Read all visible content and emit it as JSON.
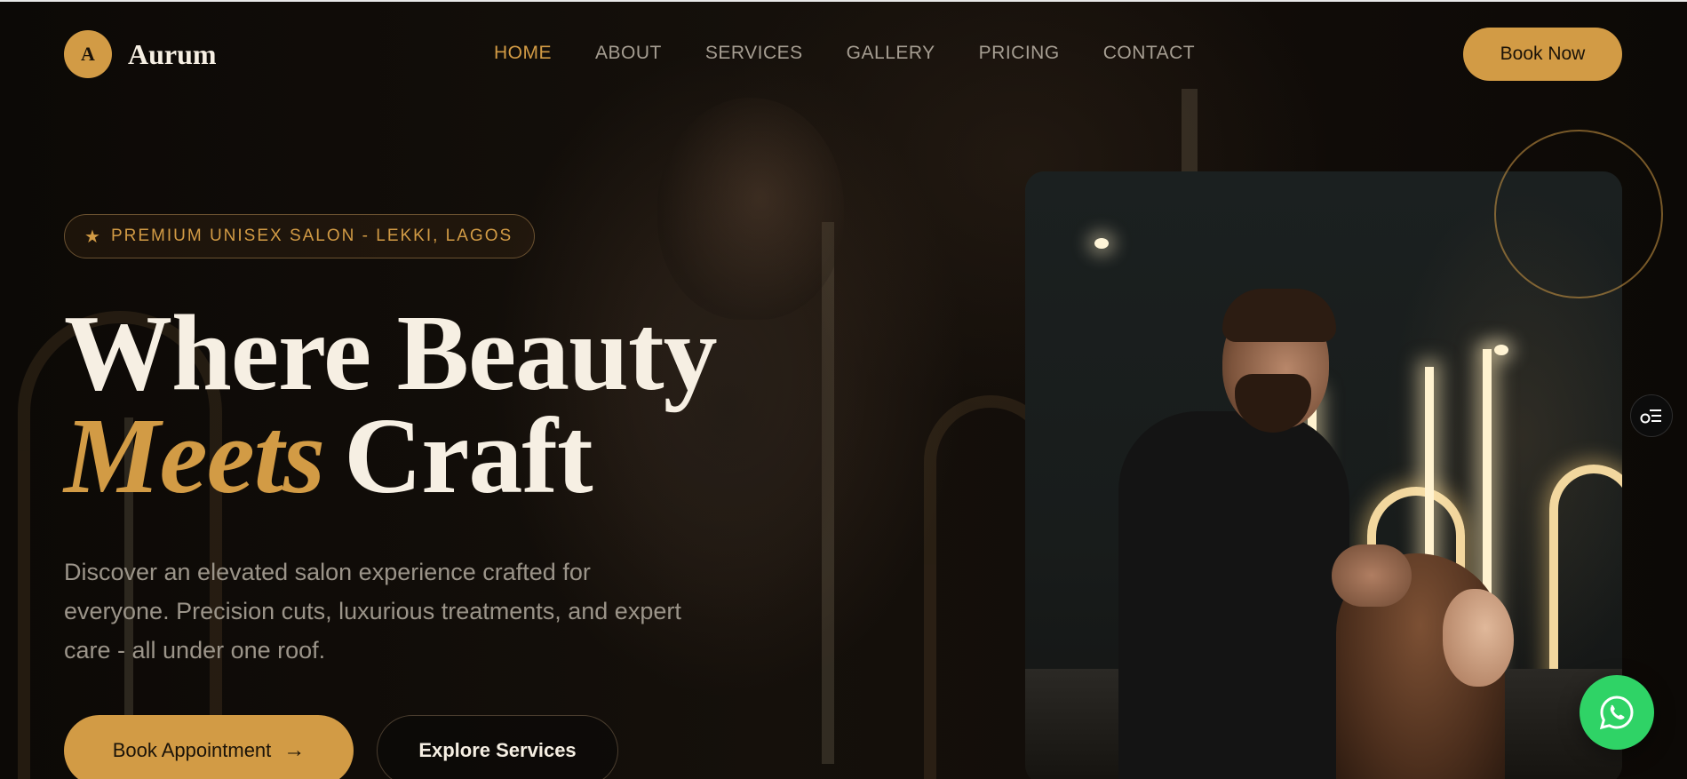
{
  "brand": {
    "logo_letter": "A",
    "name": "Aurum",
    "accent": "#d29b45"
  },
  "nav": {
    "items": [
      {
        "label": "HOME",
        "active": true
      },
      {
        "label": "ABOUT",
        "active": false
      },
      {
        "label": "SERVICES",
        "active": false
      },
      {
        "label": "GALLERY",
        "active": false
      },
      {
        "label": "PRICING",
        "active": false
      },
      {
        "label": "CONTACT",
        "active": false
      }
    ],
    "cta_label": "Book Now"
  },
  "hero": {
    "badge_icon": "star-icon",
    "badge_text": "PREMIUM UNISEX SALON - LEKKI, LAGOS",
    "headline_line1": "Where Beauty",
    "headline_accent": "Meets",
    "headline_rest": "Craft",
    "lead": "Discover an elevated salon experience crafted for everyone. Precision cuts, luxurious treatments, and expert care - all under one roof.",
    "primary_cta": "Book Appointment",
    "primary_cta_icon": "arrow-right-icon",
    "secondary_cta": "Explore Services"
  },
  "floating": {
    "whatsapp_icon": "whatsapp-icon",
    "side_widget_icon": "filter-list-icon",
    "whatsapp_color": "#2fd366"
  }
}
